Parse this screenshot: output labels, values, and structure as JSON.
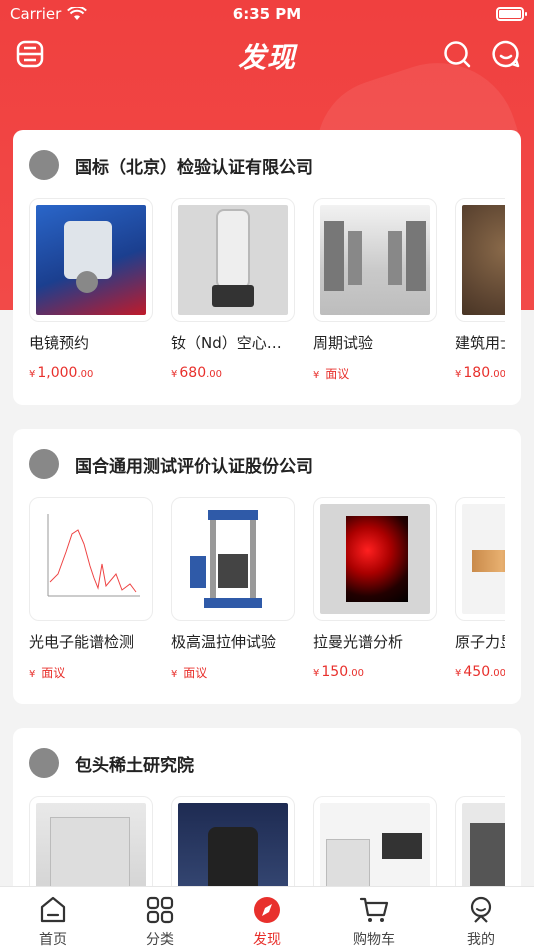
{
  "status": {
    "carrier": "Carrier",
    "time": "6:35 PM"
  },
  "nav": {
    "title": "发现",
    "left_icon": "scan-icon",
    "right_icons": [
      "search-icon",
      "message-icon"
    ]
  },
  "accent": "#e8302c",
  "shops": [
    {
      "name": "国标（北京）检验认证有限公司",
      "products": [
        {
          "name": "电镜预约",
          "price_currency": "¥",
          "price_int": "1,000",
          "price_dec": ".00",
          "negotiable": ""
        },
        {
          "name": "钕（Nd）空心…",
          "price_currency": "¥",
          "price_int": "680",
          "price_dec": ".00",
          "negotiable": ""
        },
        {
          "name": "周期试验",
          "price_currency": "¥",
          "price_int": "",
          "price_dec": "",
          "negotiable": "面议"
        },
        {
          "name": "建筑用士",
          "price_currency": "¥",
          "price_int": "180",
          "price_dec": ".00",
          "negotiable": ""
        }
      ]
    },
    {
      "name": "国合通用测试评价认证股份公司",
      "products": [
        {
          "name": "光电子能谱检测",
          "price_currency": "¥",
          "price_int": "",
          "price_dec": "",
          "negotiable": "面议"
        },
        {
          "name": "极高温拉伸试验",
          "price_currency": "¥",
          "price_int": "",
          "price_dec": "",
          "negotiable": "面议"
        },
        {
          "name": "拉曼光谱分析",
          "price_currency": "¥",
          "price_int": "150",
          "price_dec": ".00",
          "negotiable": ""
        },
        {
          "name": "原子力显",
          "price_currency": "¥",
          "price_int": "450",
          "price_dec": ".00",
          "negotiable": ""
        }
      ]
    },
    {
      "name": "包头稀土研究院",
      "products": [
        {
          "name": "",
          "price_currency": "",
          "price_int": "",
          "price_dec": "",
          "negotiable": ""
        },
        {
          "name": "",
          "price_currency": "",
          "price_int": "",
          "price_dec": "",
          "negotiable": ""
        },
        {
          "name": "",
          "price_currency": "",
          "price_int": "",
          "price_dec": "",
          "negotiable": ""
        },
        {
          "name": "",
          "price_currency": "",
          "price_int": "",
          "price_dec": "",
          "negotiable": ""
        }
      ]
    }
  ],
  "tabs": [
    {
      "label": "首页",
      "icon": "home-icon",
      "active": false
    },
    {
      "label": "分类",
      "icon": "category-icon",
      "active": false
    },
    {
      "label": "发现",
      "icon": "discover-icon",
      "active": true
    },
    {
      "label": "购物车",
      "icon": "cart-icon",
      "active": false
    },
    {
      "label": "我的",
      "icon": "profile-icon",
      "active": false
    }
  ]
}
